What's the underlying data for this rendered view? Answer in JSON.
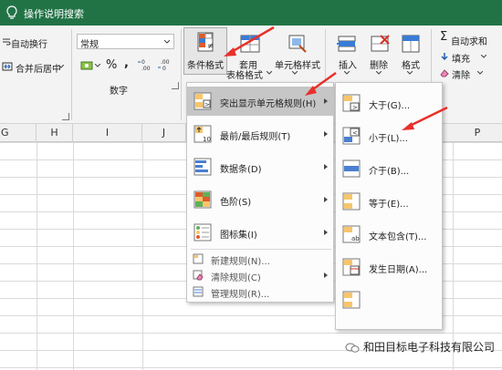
{
  "titlebar": {
    "search_text": "操作说明搜索"
  },
  "ribbon": {
    "align": {
      "wrap_text": "自动换行",
      "merge_center": "合并后居中"
    },
    "number": {
      "format_value": "常规",
      "percent": "%",
      "comma": ",",
      "group_label": "数字"
    },
    "styles": {
      "conditional_formatting": "条件格式",
      "table_format_line1": "套用",
      "table_format_line2": "表格格式",
      "cell_styles": "单元格样式"
    },
    "cells": {
      "insert": "插入",
      "delete": "删除",
      "format": "格式"
    },
    "editing": {
      "autosum": "自动求和",
      "fill": "填充",
      "clear": "清除"
    }
  },
  "sheet": {
    "columns": [
      "G",
      "H",
      "I",
      "J",
      "P"
    ]
  },
  "cf_menu": {
    "items": [
      {
        "label": "突出显示单元格规则(H)",
        "icon": "highlight-rules-icon"
      },
      {
        "label": "最前/最后规则(T)",
        "icon": "top-bottom-icon"
      },
      {
        "label": "数据条(D)",
        "icon": "data-bars-icon"
      },
      {
        "label": "色阶(S)",
        "icon": "color-scales-icon"
      },
      {
        "label": "图标集(I)",
        "icon": "icon-sets-icon"
      }
    ],
    "small_items": [
      {
        "label": "新建规则(N)...",
        "icon": "new-rule-icon"
      },
      {
        "label": "清除规则(C)",
        "icon": "clear-rules-icon"
      },
      {
        "label": "管理规则(R)...",
        "icon": "manage-rules-icon"
      }
    ]
  },
  "sub_menu": {
    "items": [
      {
        "label": "大于(G)...",
        "icon": "greater-than-icon"
      },
      {
        "label": "小于(L)...",
        "icon": "less-than-icon"
      },
      {
        "label": "介于(B)...",
        "icon": "between-icon"
      },
      {
        "label": "等于(E)...",
        "icon": "equal-to-icon"
      },
      {
        "label": "文本包含(T)...",
        "icon": "text-contains-icon"
      },
      {
        "label": "发生日期(A)...",
        "icon": "date-occurring-icon"
      }
    ]
  },
  "watermark": {
    "text": "和田目标电子科技有限公司"
  },
  "colors": {
    "excel_green": "#217346",
    "annotation_red": "#e8302a",
    "menu_highlight": "#c6c6c6"
  }
}
